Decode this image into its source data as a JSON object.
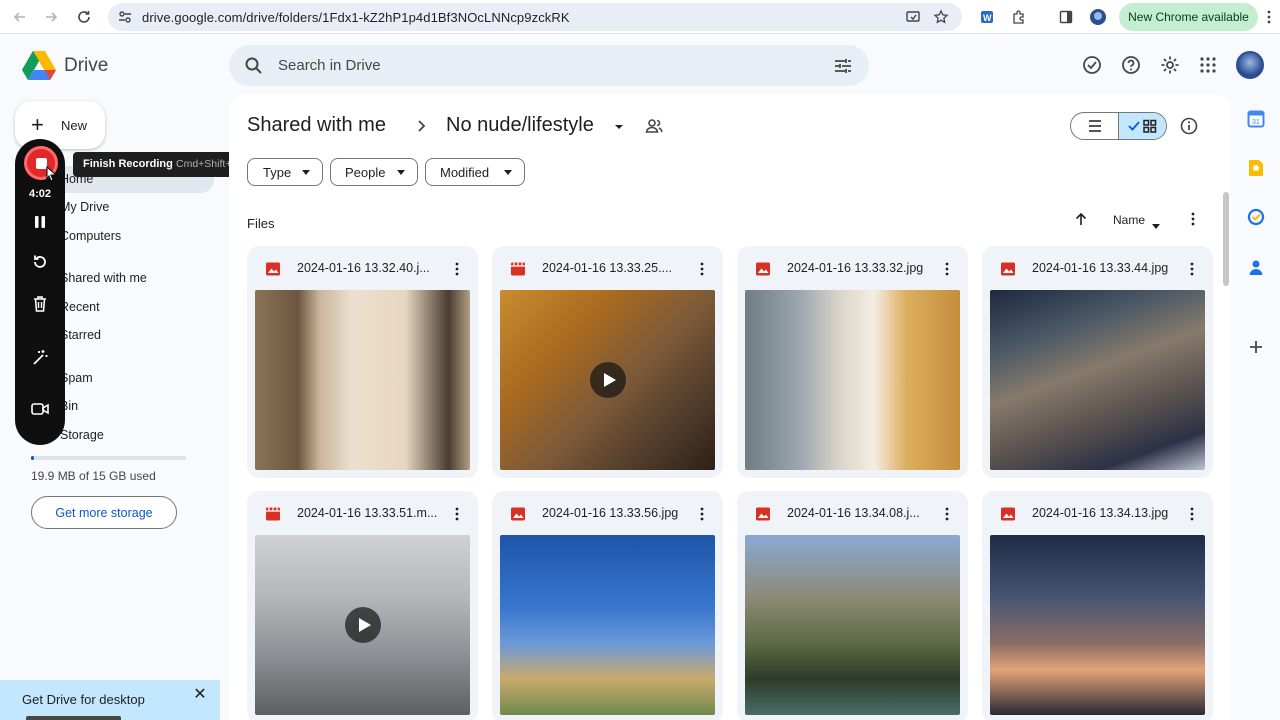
{
  "browser": {
    "url": "drive.google.com/drive/folders/1Fdx1-kZ2hP1p4d1Bf3NOcLNNcp9zckRK",
    "update_label": "New Chrome available"
  },
  "header": {
    "brand": "Drive",
    "search_placeholder": "Search in Drive"
  },
  "sidebar": {
    "new_label": "New",
    "items": [
      {
        "label": "Home"
      },
      {
        "label": "My Drive"
      },
      {
        "label": "Computers"
      },
      {
        "label": "Shared with me"
      },
      {
        "label": "Recent"
      },
      {
        "label": "Starred"
      },
      {
        "label": "Spam"
      },
      {
        "label": "Bin"
      },
      {
        "label": "Storage"
      }
    ],
    "storage_text": "19.9 MB of 15 GB used",
    "storage_fraction": 0.0013,
    "get_storage_label": "Get more storage",
    "promo_text": "Get Drive for desktop"
  },
  "recorder": {
    "timer": "4:02",
    "tooltip_title": "Finish Recording",
    "tooltip_shortcut": "Cmd+Shift+L"
  },
  "breadcrumb": {
    "parent": "Shared with me",
    "current": "No nude/lifestyle"
  },
  "filters": [
    {
      "label": "Type"
    },
    {
      "label": "People"
    },
    {
      "label": "Modified"
    }
  ],
  "files_section": {
    "label": "Files",
    "sort_label": "Name"
  },
  "files": [
    {
      "name": "2024-01-16 13.32.40.j...",
      "kind": "image"
    },
    {
      "name": "2024-01-16 13.33.25....",
      "kind": "video"
    },
    {
      "name": "2024-01-16 13.33.32.jpg",
      "kind": "image"
    },
    {
      "name": "2024-01-16 13.33.44.jpg",
      "kind": "image"
    },
    {
      "name": "2024-01-16 13.33.51.m...",
      "kind": "video"
    },
    {
      "name": "2024-01-16 13.33.56.jpg",
      "kind": "image"
    },
    {
      "name": "2024-01-16 13.34.08.j...",
      "kind": "image"
    },
    {
      "name": "2024-01-16 13.34.13.jpg",
      "kind": "image"
    }
  ],
  "colors": {
    "accent": "#0b57d0",
    "file_icon_red": "#d93025",
    "selected_view": "#c2e7ff",
    "recorder_red": "#e22828"
  }
}
